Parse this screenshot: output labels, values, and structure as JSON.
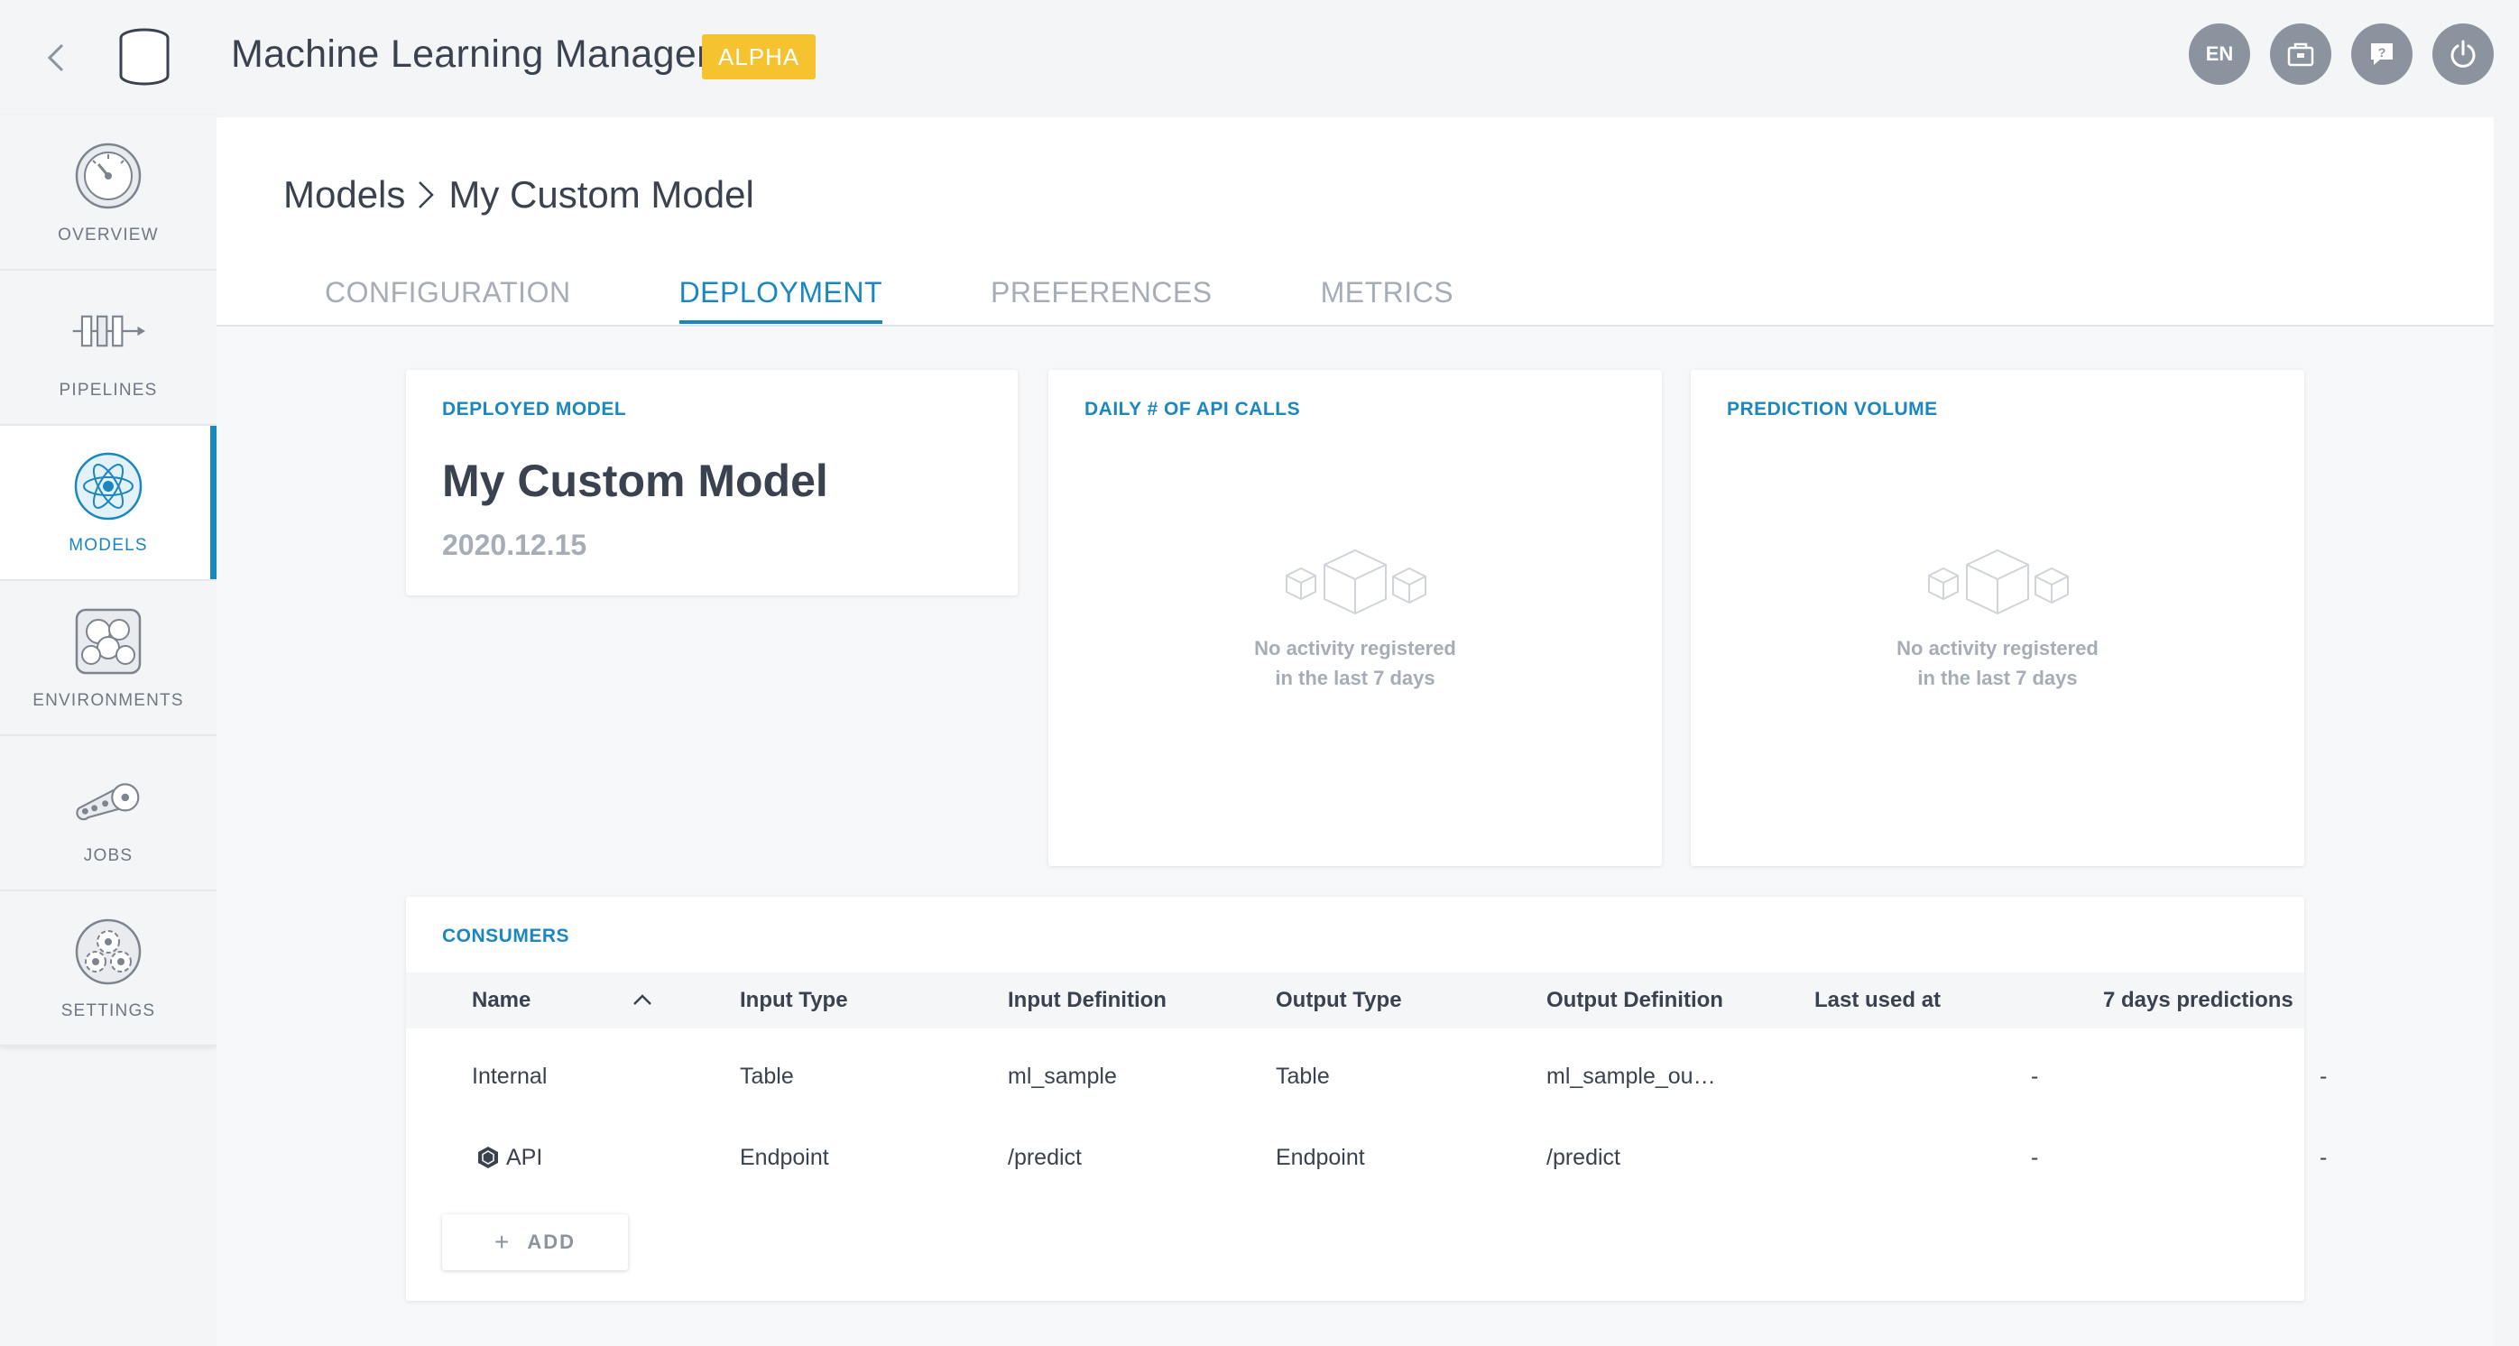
{
  "app": {
    "title": "Machine Learning Manager",
    "badge": "ALPHA",
    "language": "EN",
    "accent_color": "#1b87c0",
    "badge_color": "#f5c230"
  },
  "top_actions": [
    {
      "name": "language-button",
      "label": "EN"
    },
    {
      "name": "app-store-icon",
      "icon": "store"
    },
    {
      "name": "help-icon",
      "icon": "question"
    },
    {
      "name": "power-icon",
      "icon": "power"
    }
  ],
  "sidebar": {
    "items": [
      {
        "label": "OVERVIEW",
        "icon": "gauge-icon"
      },
      {
        "label": "PIPELINES",
        "icon": "pipeline-icon"
      },
      {
        "label": "MODELS",
        "icon": "atom-icon",
        "active": true
      },
      {
        "label": "ENVIRONMENTS",
        "icon": "environment-icon"
      },
      {
        "label": "JOBS",
        "icon": "conveyor-icon"
      },
      {
        "label": "SETTINGS",
        "icon": "gears-icon"
      }
    ]
  },
  "breadcrumb": {
    "root": "Models",
    "current": "My Custom Model"
  },
  "tabs": [
    {
      "label": "CONFIGURATION",
      "active": false
    },
    {
      "label": "DEPLOYMENT",
      "active": true
    },
    {
      "label": "PREFERENCES",
      "active": false
    },
    {
      "label": "METRICS",
      "active": false
    }
  ],
  "deployed_model": {
    "title": "DEPLOYED MODEL",
    "name": "My Custom Model",
    "version": "2020.12.15"
  },
  "api_calls": {
    "title": "DAILY # OF API CALLS",
    "empty_line1": "No activity registered",
    "empty_line2": "in the last 7 days"
  },
  "prediction_volume": {
    "title": "PREDICTION VOLUME",
    "empty_line1": "No activity registered",
    "empty_line2": "in the last 7 days"
  },
  "consumers": {
    "title": "CONSUMERS",
    "columns": [
      "Name",
      "Input Type",
      "Input Definition",
      "Output Type",
      "Output Definition",
      "Last used at",
      "7 days predictions"
    ],
    "rows": [
      {
        "name": "Internal",
        "input_type": "Table",
        "input_def": "ml_sample",
        "output_type": "Table",
        "output_def": "ml_sample_ou…",
        "last_used": "-",
        "predictions": "-"
      },
      {
        "name": "API",
        "input_type": "Endpoint",
        "input_def": "/predict",
        "output_type": "Endpoint",
        "output_def": "/predict",
        "last_used": "-",
        "predictions": "-"
      }
    ],
    "add_label": "ADD"
  }
}
